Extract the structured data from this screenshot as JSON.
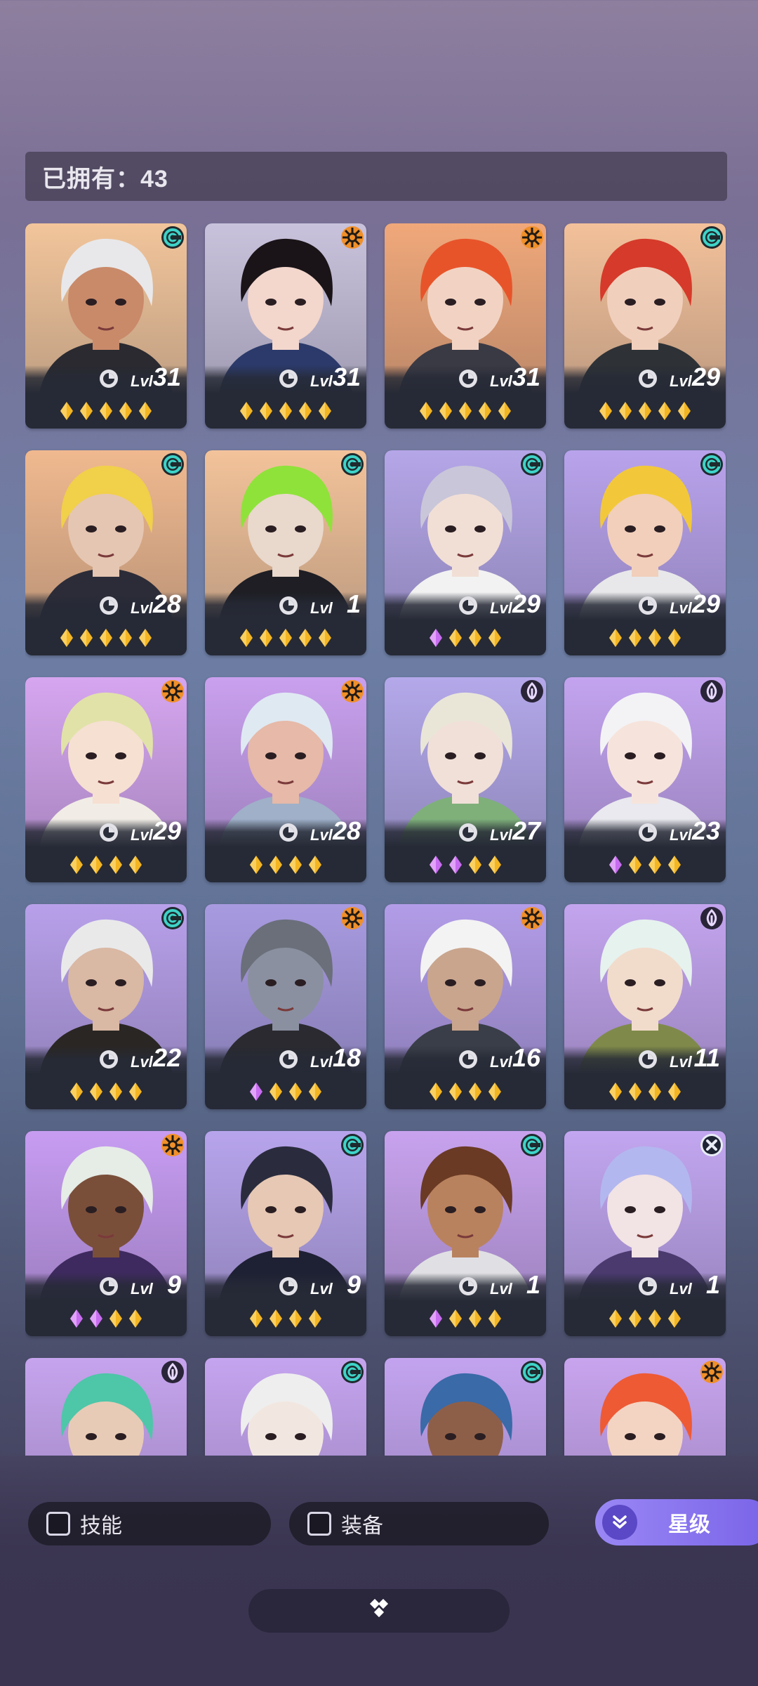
{
  "owned": {
    "label": "已拥有：43"
  },
  "level_prefix": "Lvl",
  "heroes": [
    {
      "level": "31",
      "class": "spiral",
      "stars": [
        "gold",
        "gold",
        "gold",
        "gold",
        "gold"
      ],
      "bg": "#f2c59b",
      "hair": "#e8e8ea",
      "skin": "#c98a6a",
      "cloth": "#2a2a30"
    },
    {
      "level": "31",
      "class": "sun",
      "stars": [
        "gold",
        "gold",
        "gold",
        "gold",
        "gold"
      ],
      "bg": "#c9c2dc",
      "hair": "#1a1418",
      "skin": "#f3d6cc",
      "cloth": "#2b3a6a"
    },
    {
      "level": "31",
      "class": "sun",
      "stars": [
        "gold",
        "gold",
        "gold",
        "gold",
        "gold"
      ],
      "bg": "#f0a87a",
      "hair": "#e8542a",
      "skin": "#f2d3c3",
      "cloth": "#3a3a44"
    },
    {
      "level": "29",
      "class": "spiral",
      "stars": [
        "gold",
        "gold",
        "gold",
        "gold",
        "gold"
      ],
      "bg": "#f3c19a",
      "hair": "#d63a2a",
      "skin": "#f1cfbd",
      "cloth": "#2e3236"
    },
    {
      "level": "28",
      "class": "spiral",
      "stars": [
        "gold",
        "gold",
        "gold",
        "gold",
        "gold"
      ],
      "bg": "#f0b98f",
      "hair": "#f1d04a",
      "skin": "#e5c6b2",
      "cloth": "#2c2c38"
    },
    {
      "level": "1",
      "class": "spiral",
      "stars": [
        "gold",
        "gold",
        "gold",
        "gold",
        "gold"
      ],
      "bg": "#f3c39a",
      "hair": "#8fe23a",
      "skin": "#e9d8cc",
      "cloth": "#1e1e24"
    },
    {
      "level": "29",
      "class": "spiral",
      "stars": [
        "purple",
        "gold",
        "gold",
        "gold"
      ],
      "bg": "#b5a6e8",
      "hair": "#c9c6d9",
      "skin": "#f1dfd6",
      "cloth": "#f2f2f2"
    },
    {
      "level": "29",
      "class": "spiral",
      "stars": [
        "gold",
        "gold",
        "gold",
        "gold"
      ],
      "bg": "#b9a3ec",
      "hair": "#f2c83a",
      "skin": "#f1cfbb",
      "cloth": "#e8e8ea"
    },
    {
      "level": "29",
      "class": "sun",
      "stars": [
        "gold",
        "gold",
        "gold",
        "gold"
      ],
      "bg": "#d6a6f0",
      "hair": "#e1e2a8",
      "skin": "#f6e0d2",
      "cloth": "#f1ede6"
    },
    {
      "level": "28",
      "class": "sun",
      "stars": [
        "gold",
        "gold",
        "gold",
        "gold"
      ],
      "bg": "#c9a0ee",
      "hair": "#dfe9f2",
      "skin": "#e6b9a8",
      "cloth": "#9fb0c8"
    },
    {
      "level": "27",
      "class": "flame",
      "stars": [
        "purple",
        "purple",
        "gold",
        "gold"
      ],
      "bg": "#b4a8ea",
      "hair": "#e9e6d8",
      "skin": "#f1e0d8",
      "cloth": "#7fb07a"
    },
    {
      "level": "23",
      "class": "flame",
      "stars": [
        "purple",
        "gold",
        "gold",
        "gold"
      ],
      "bg": "#c3a3ef",
      "hair": "#f3f3f6",
      "skin": "#f6e4dc",
      "cloth": "#e9e9ef"
    },
    {
      "level": "22",
      "class": "spiral",
      "stars": [
        "gold",
        "gold",
        "gold",
        "gold"
      ],
      "bg": "#b8a0ea",
      "hair": "#e9e9ea",
      "skin": "#d9b8a4",
      "cloth": "#2a2624"
    },
    {
      "level": "18",
      "class": "sun",
      "stars": [
        "purple",
        "gold",
        "gold",
        "gold"
      ],
      "bg": "#a89ae0",
      "hair": "#6a6f7a",
      "skin": "#8a90a0",
      "cloth": "#2a2a30"
    },
    {
      "level": "16",
      "class": "sun",
      "stars": [
        "gold",
        "gold",
        "gold",
        "gold"
      ],
      "bg": "#b29ce8",
      "hair": "#f3f3f3",
      "skin": "#c9a58e",
      "cloth": "#3a3e48"
    },
    {
      "level": "11",
      "class": "flame",
      "stars": [
        "gold",
        "gold",
        "gold",
        "gold"
      ],
      "bg": "#c3a4ee",
      "hair": "#e6f2ee",
      "skin": "#f1dccc",
      "cloth": "#7f8a4a"
    },
    {
      "level": "9",
      "class": "sun",
      "stars": [
        "purple",
        "purple",
        "gold",
        "gold"
      ],
      "bg": "#c79cf2",
      "hair": "#e6ece6",
      "skin": "#7a4f3a",
      "cloth": "#3e2a5e"
    },
    {
      "level": "9",
      "class": "spiral",
      "stars": [
        "gold",
        "gold",
        "gold",
        "gold"
      ],
      "bg": "#b7a4ec",
      "hair": "#2a2c3e",
      "skin": "#e6c8b4",
      "cloth": "#1e2034"
    },
    {
      "level": "1",
      "class": "spiral",
      "stars": [
        "purple",
        "gold",
        "gold",
        "gold"
      ],
      "bg": "#c8a2ee",
      "hair": "#6a3a24",
      "skin": "#b9825e",
      "cloth": "#e0e0e4"
    },
    {
      "level": "1",
      "class": "cross",
      "stars": [
        "gold",
        "gold",
        "gold",
        "gold"
      ],
      "bg": "#c2a6f0",
      "hair": "#b3b7ef",
      "skin": "#f2e3e4",
      "cloth": "#4a3a6e"
    },
    {
      "level": "",
      "class": "flame",
      "stars": [],
      "bg": "#c6a4ee",
      "hair": "#4ec6a8",
      "skin": "#e8cbb6",
      "cloth": "#2a4a44"
    },
    {
      "level": "",
      "class": "spiral",
      "stars": [],
      "bg": "#c5a4ef",
      "hair": "#eeeeee",
      "skin": "#f2e7e0",
      "cloth": "#f0f0f0"
    },
    {
      "level": "",
      "class": "spiral",
      "stars": [],
      "bg": "#c3a3ef",
      "hair": "#3a6aa8",
      "skin": "#8e5f48",
      "cloth": "#2a3e6a"
    },
    {
      "level": "",
      "class": "sun",
      "stars": [],
      "bg": "#c8a4ee",
      "hair": "#ee5a34",
      "skin": "#f3d4c3",
      "cloth": "#d8b27a"
    }
  ],
  "filters": {
    "skill": "技能",
    "equipment": "装备"
  },
  "sort": {
    "label": "星级"
  },
  "icons": {
    "class_spiral": "spiral-class-icon",
    "class_sun": "sun-class-icon",
    "class_flame": "flame-class-icon",
    "class_cross": "cross-class-icon",
    "star_gold": "gold-star-gem-icon",
    "star_purple": "purple-star-gem-icon",
    "sort": "double-chevron-down-icon",
    "collapse": "diamond-cluster-icon"
  },
  "colors": {
    "accent": "#8b76f0",
    "gold": "#f3b522",
    "purple": "#c86cf0",
    "card": "#262a36",
    "spiral": "#3ed3c8",
    "sun": "#f0902a"
  }
}
